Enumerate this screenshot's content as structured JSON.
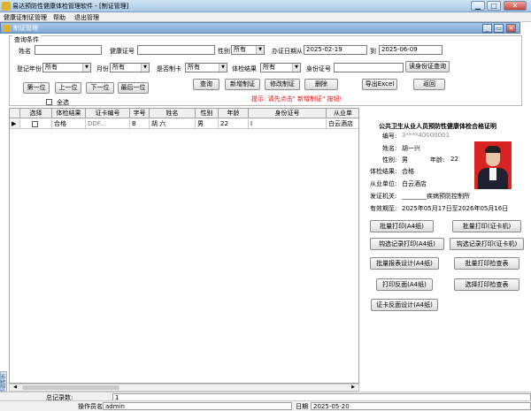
{
  "window": {
    "title": "易达预防性健康体检管理软件 - [制证管理]",
    "min": "▁",
    "max": "□",
    "close": "✕"
  },
  "menu": [
    "健康证制证管理",
    "帮助",
    "退出管理"
  ],
  "mdi": {
    "title": "制证管理",
    "min": "_",
    "restore": "▭",
    "close": "×"
  },
  "query": {
    "group_title": "查询条件",
    "name_label": "姓名",
    "cert_label": "健康证号",
    "gender_label": "性别",
    "gender_value": "所有",
    "date_label": "办证日期从",
    "date_from": "2025-02-19",
    "date_to_label": "到",
    "date_to": "2025-06-09",
    "year_label": "登记年份",
    "year_value": "所有",
    "month_label": "月份",
    "month_value": "所有",
    "made_label": "是否制卡",
    "made_value": "所有",
    "result_label": "体检结果",
    "result_value": "所有",
    "id_label": "身份证号",
    "read_id_btn": "读身份证查询",
    "first_btn": "第一位",
    "prev_btn": "上一位",
    "next_btn": "下一位",
    "last_btn": "最后一位",
    "search_btn": "查询",
    "new_btn": "新增制证",
    "edit_btn": "修改制证",
    "delete_btn": "删除",
    "export_btn": "导出Excel",
    "back_btn": "返回",
    "hint": "提示: 请先点击\" 新增制证\" 按钮!",
    "select_all": "全选"
  },
  "grid": {
    "headers": [
      "选择",
      "体检结果",
      "证卡编号",
      "字号",
      "姓名",
      "性别",
      "年龄",
      "身份证号",
      "从业单"
    ],
    "row": {
      "marker": "▶",
      "result": "合格",
      "card_no": "DDF...",
      "zihao": "B",
      "name": "胡 六",
      "gender": "男",
      "age": "22",
      "id": "I",
      "unit": "白云酒店"
    }
  },
  "cert": {
    "title": "公共卫生从业人员预防性健康体检合格证明",
    "no_label": "编号:",
    "no_value": "3****40000001",
    "name_label": "姓名:",
    "name_value": "胡一兴",
    "gender_label": "性别:",
    "gender_value": "男",
    "age_label": "年龄:",
    "age_value": "22",
    "result_label": "体检结果:",
    "result_value": "合格",
    "unit_label": "从业单位:",
    "unit_value": "白云酒店",
    "issuer_label": "发证机关:",
    "issuer_value": "________疾病预防控制所",
    "valid_label": "有效期至:",
    "valid_value": "2025年05月17日至2026年05月16日"
  },
  "actions": {
    "batch_print_a4": "批量打印(A4纸)",
    "batch_print_card": "批量打印(证卡机)",
    "check_print_a4": "钩选记录打印(A4纸)",
    "check_print_card": "钩选记录打印(证卡机)",
    "batch_design": "批量报表设计(A4纸)",
    "batch_print_sheet": "批量打印检查表",
    "print_back": "打印反面(A4纸)",
    "select_print_sheet": "选择打印检查表",
    "back_design": "证卡反面设计(A4纸)"
  },
  "status": {
    "total_label": "总记录数:",
    "total_value": "1",
    "operator_label": "操作员名",
    "operator_value": "admin",
    "date_label": "日期",
    "date_value": "2025-05-20"
  },
  "sidetab": "系统导航"
}
